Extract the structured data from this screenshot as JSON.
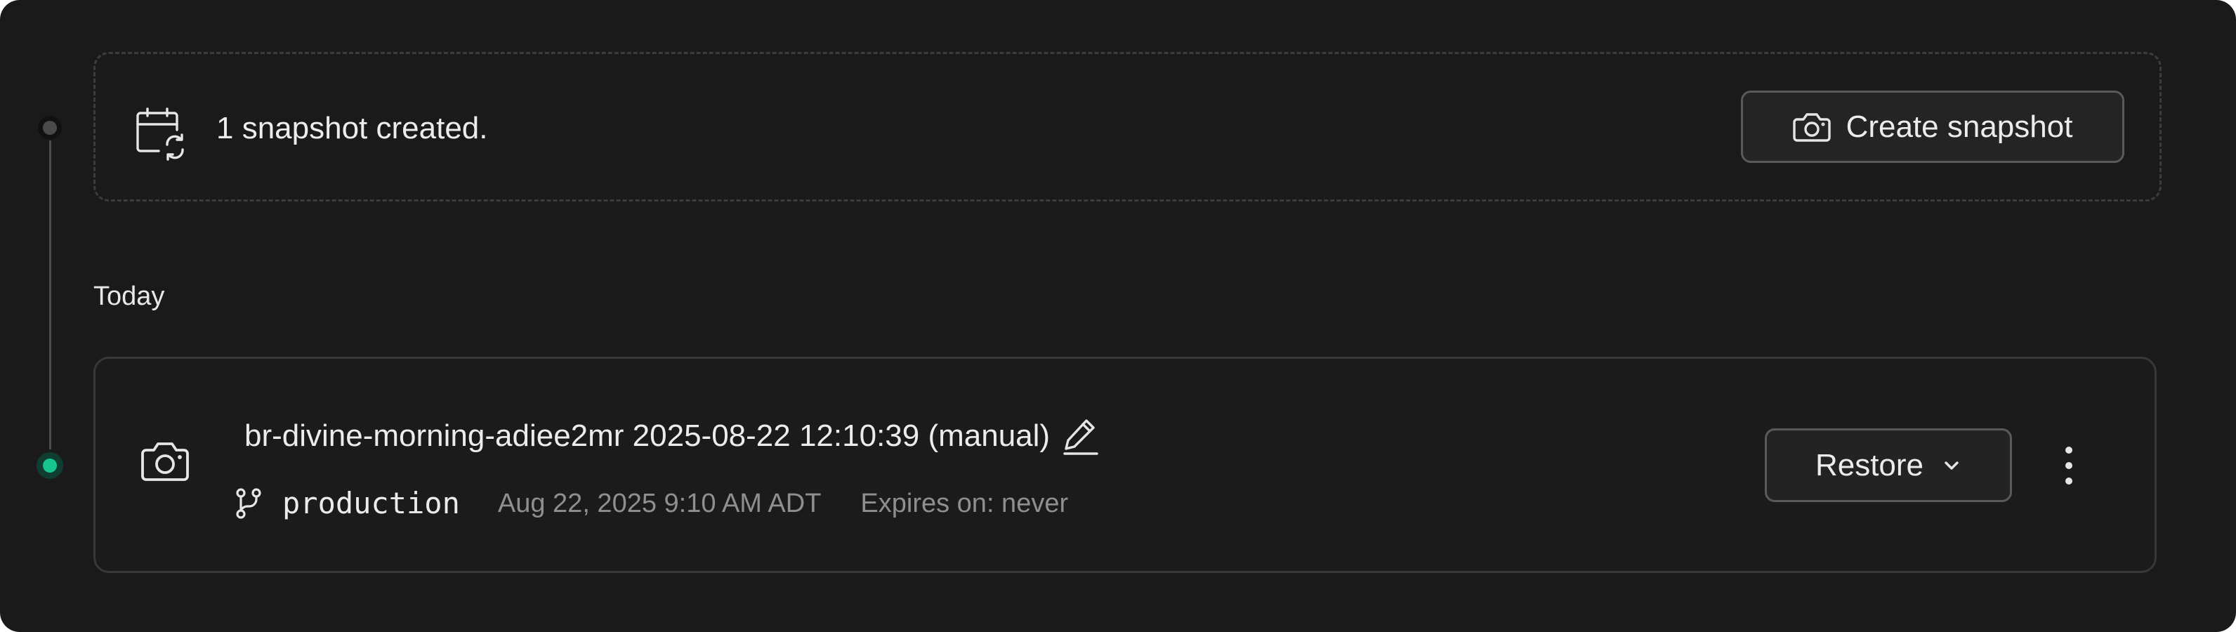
{
  "timeline": {
    "active_color": "#18c58e"
  },
  "summary": {
    "icon": "calendar-sync-icon",
    "text": "1 snapshot created.",
    "create_button": {
      "icon": "camera-icon",
      "label": "Create snapshot"
    }
  },
  "groups": [
    {
      "label": "Today",
      "snapshots": [
        {
          "icon": "camera-icon",
          "title": "br-divine-morning-adiee2mr 2025-08-22 12:10:39 (manual)",
          "edit_icon": "pencil-icon",
          "branch_icon": "git-branch-icon",
          "branch": "production",
          "date": "Aug 22, 2025 9:10 AM ADT",
          "expiry": "Expires on: never",
          "restore_button": {
            "label": "Restore",
            "icon": "chevron-down-icon"
          },
          "more_icon": "more-vertical-icon"
        }
      ]
    }
  ]
}
